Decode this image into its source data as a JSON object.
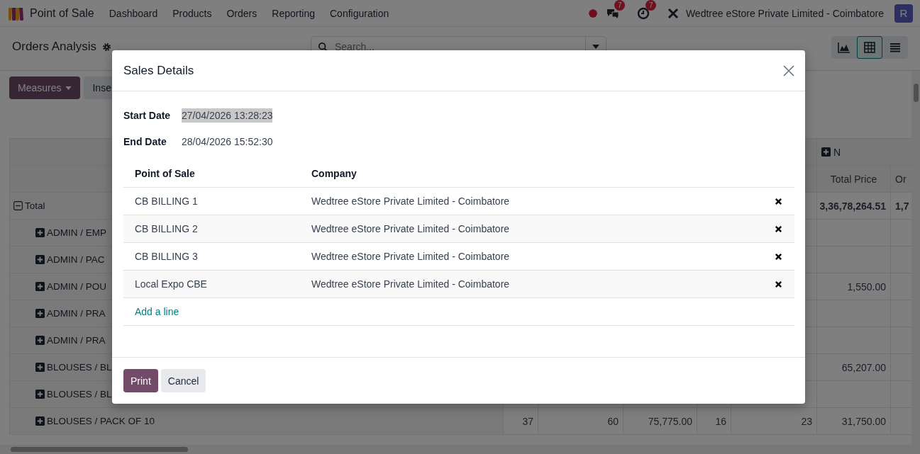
{
  "navbar": {
    "app_name": "Point of Sale",
    "menu": [
      "Dashboard",
      "Products",
      "Orders",
      "Reporting",
      "Configuration"
    ],
    "messages_badge": "7",
    "activities_badge": "7",
    "company": "Wedtree eStore Private Limited - Coimbatore",
    "avatar": "R"
  },
  "control_panel": {
    "title": "Orders Analysis",
    "search": {
      "placeholder": "Search..."
    },
    "views": [
      {
        "kind": "graph",
        "selected": false
      },
      {
        "kind": "pivot",
        "selected": true
      },
      {
        "kind": "list",
        "selected": false
      }
    ],
    "buttons": [
      {
        "label": "Measures",
        "kind": "primary"
      },
      {
        "label": "Inse",
        "kind": "secondary"
      }
    ]
  },
  "pivot": {
    "group_header": {
      "label": "N",
      "expanded": false
    },
    "measures": {
      "total_price": "Total Price",
      "column_7": "Or"
    },
    "rows": [
      {
        "label": "Total",
        "expanded": true,
        "cells": {
          "total_price": "3,36,78,264.51",
          "column_7": "1,7"
        },
        "children": [
          {
            "label": "ADMIN / EMP",
            "expanded": false
          },
          {
            "label": "ADMIN / PAC",
            "expanded": false
          },
          {
            "label": "ADMIN / POU",
            "expanded": false,
            "cells": {
              "total_price": "1,550.00"
            }
          },
          {
            "label": "ADMIN / PRA",
            "expanded": false
          },
          {
            "label": "ADMIN / PRA",
            "expanded": false
          },
          {
            "label": "BLOUSES / BL",
            "expanded": false,
            "cells": {
              "total_price": "65,207.00"
            }
          },
          {
            "label": "BLOUSES / BL",
            "expanded": false
          },
          {
            "label": "BLOUSES / PACK OF 10",
            "expanded": false,
            "cells": {
              "column_1": "37",
              "column_2": "60",
              "column_3": "75,775.00",
              "column_4": "16",
              "column_5": "23",
              "total_price": "31,750.00"
            }
          }
        ]
      }
    ]
  },
  "dialog": {
    "title": "Sales Details",
    "fields": [
      {
        "label": "Start Date",
        "value": "27/04/2026 13:28:23",
        "highlighted": true
      },
      {
        "label": "End Date",
        "value": "28/04/2026 15:52:30",
        "highlighted": false
      }
    ],
    "columns": [
      "Point of Sale",
      "Company"
    ],
    "rows": [
      {
        "point_of_sale": "CB BILLING 1",
        "company": "Wedtree eStore Private Limited - Coimbatore"
      },
      {
        "point_of_sale": "CB BILLING 2",
        "company": "Wedtree eStore Private Limited - Coimbatore"
      },
      {
        "point_of_sale": "CB BILLING 3",
        "company": "Wedtree eStore Private Limited - Coimbatore"
      },
      {
        "point_of_sale": "Local Expo CBE",
        "company": "Wedtree eStore Private Limited - Coimbatore"
      }
    ],
    "add_line": "Add a line",
    "buttons": [
      {
        "label": "Print",
        "kind": "primary"
      },
      {
        "label": "Cancel",
        "kind": "secondary"
      }
    ]
  }
}
